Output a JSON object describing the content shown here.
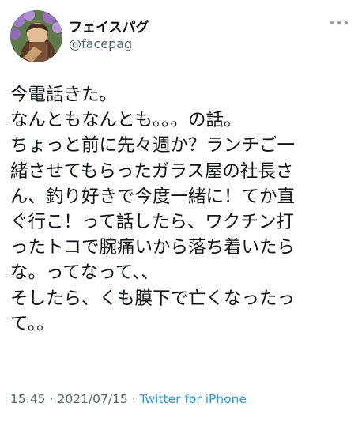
{
  "user": {
    "display_name": "フェイスパグ",
    "handle": "@facepag"
  },
  "more_icon": "ellipsis-icon",
  "tweet": {
    "lines": [
      "今電話きた。",
      "なんともなんとも。。。の話。",
      "ちょっと前に先々週か？ランチご一",
      "緒させてもらったガラス屋の社長さ",
      "ん、釣り好きで今度一緒に！てか直",
      "ぐ行こ！って話したら、ワクチン打",
      "ったトコで腕痛いから落ち着いたら",
      "な。ってなって、、",
      "そしたら、くも膜下で亡くなったっ",
      "て。。"
    ]
  },
  "meta": {
    "time": "15:45",
    "separator": " · ",
    "date": "2021/07/15",
    "source": "Twitter for iPhone"
  },
  "colors": {
    "text": "#0f1419",
    "secondary": "#536471",
    "link": "#1d9bf0"
  }
}
